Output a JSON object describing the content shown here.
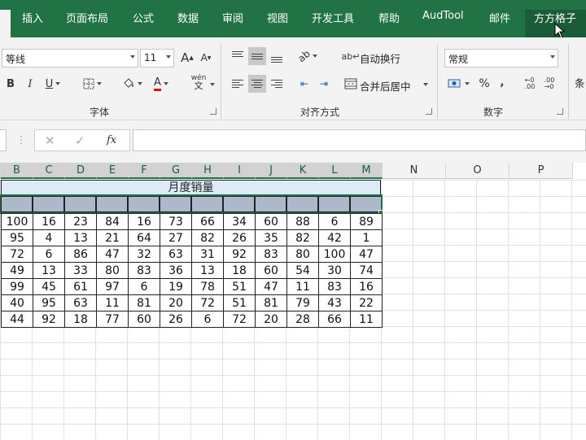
{
  "ribbon_tabs": [
    "插入",
    "页面布局",
    "公式",
    "数据",
    "审阅",
    "视图",
    "开发工具",
    "帮助",
    "AudTool",
    "邮件",
    "方方格子"
  ],
  "font_group": {
    "font_name": "等线",
    "font_size": "11",
    "grow_font": "A",
    "shrink_font": "A",
    "bold": "B",
    "italic": "I",
    "underline": "U",
    "font_color_letter": "A",
    "phonetic_top": "wén",
    "phonetic_bottom": "文",
    "label": "字体"
  },
  "alignment_group": {
    "wrap_text": "自动换行",
    "merge_center": "合并后居中",
    "label": "对齐方式"
  },
  "number_group": {
    "format": "常规",
    "percent": "%",
    "comma": ",",
    "label": "数字"
  },
  "styles_partial": "条",
  "formula_bar": {
    "fx": "fx",
    "cancel": "✕",
    "enter": "✓",
    "dots": "⋮"
  },
  "colors": {
    "ribbon_green": "#217346",
    "title_fill": "#ddebf7",
    "header_row_fill": "#acb9ca"
  },
  "columns": [
    "B",
    "C",
    "D",
    "E",
    "F",
    "G",
    "H",
    "I",
    "J",
    "K",
    "L",
    "M",
    "N",
    "O",
    "P"
  ],
  "sheet": {
    "title": "月度销量",
    "rows": [
      [
        "100",
        "16",
        "23",
        "84",
        "16",
        "73",
        "66",
        "34",
        "60",
        "88",
        "6",
        "89"
      ],
      [
        "95",
        "4",
        "13",
        "21",
        "64",
        "27",
        "82",
        "26",
        "35",
        "82",
        "42",
        "1"
      ],
      [
        "72",
        "6",
        "86",
        "47",
        "32",
        "63",
        "31",
        "92",
        "83",
        "80",
        "100",
        "47"
      ],
      [
        "49",
        "13",
        "33",
        "80",
        "83",
        "36",
        "13",
        "18",
        "60",
        "54",
        "30",
        "74"
      ],
      [
        "99",
        "45",
        "61",
        "97",
        "6",
        "19",
        "78",
        "51",
        "47",
        "11",
        "83",
        "16"
      ],
      [
        "40",
        "95",
        "63",
        "11",
        "81",
        "20",
        "72",
        "51",
        "81",
        "79",
        "43",
        "22"
      ],
      [
        "44",
        "92",
        "18",
        "77",
        "60",
        "26",
        "6",
        "72",
        "20",
        "28",
        "66",
        "11"
      ]
    ]
  }
}
